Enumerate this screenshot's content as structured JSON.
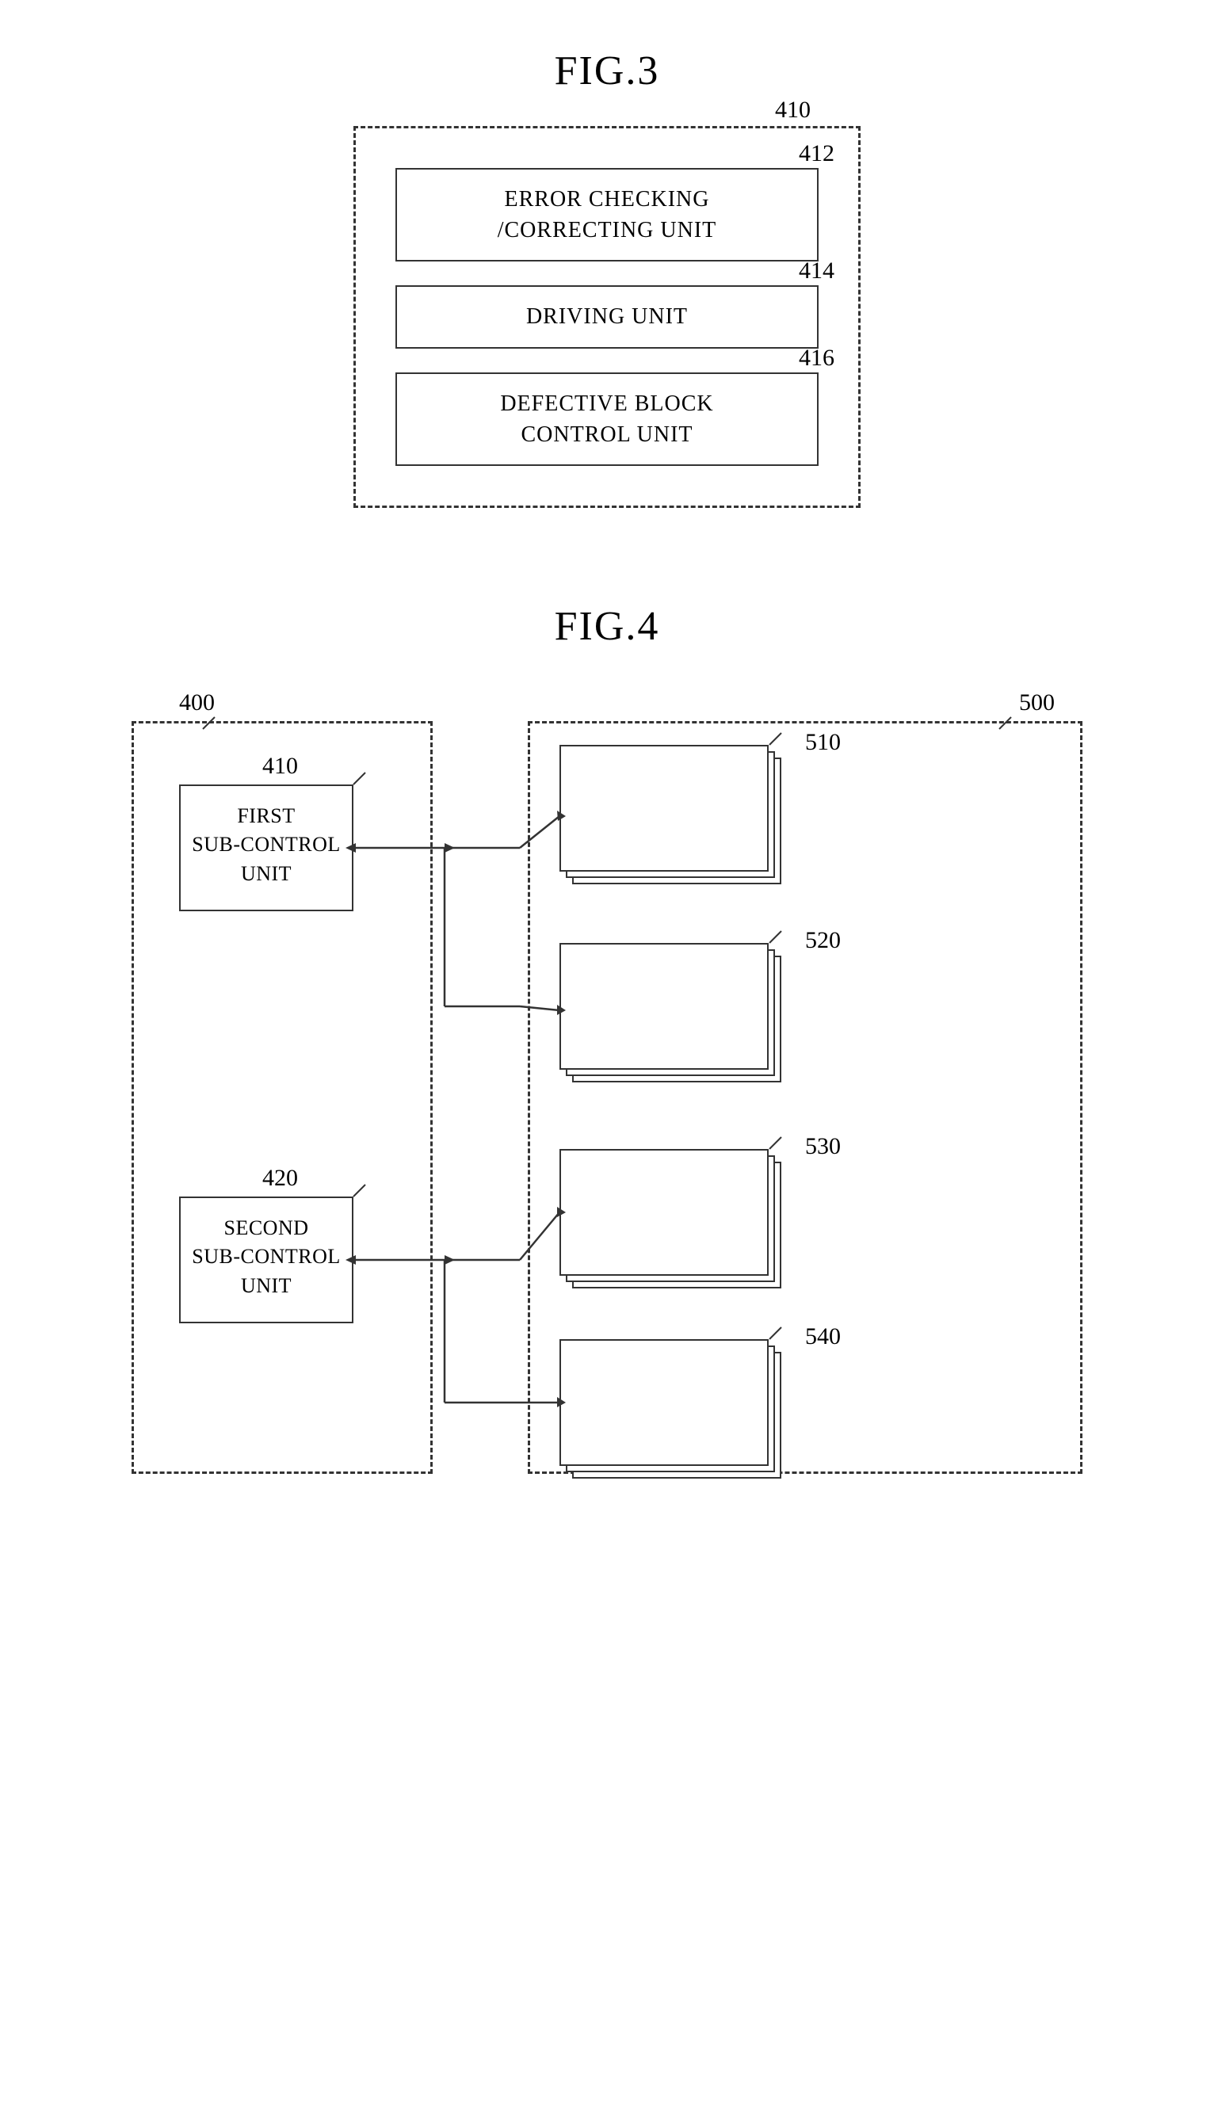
{
  "fig3": {
    "title": "FIG.3",
    "outer_ref": "410",
    "units": [
      {
        "ref": "412",
        "lines": [
          "ERROR CHECKING",
          "/CORRECTING UNIT"
        ]
      },
      {
        "ref": "414",
        "lines": [
          "DRIVING UNIT"
        ]
      },
      {
        "ref": "416",
        "lines": [
          "DEFECTIVE BLOCK",
          "CONTROL UNIT"
        ]
      }
    ]
  },
  "fig4": {
    "title": "FIG.4",
    "refs": {
      "r400": "400",
      "r500": "500",
      "r410": "410",
      "r420": "420",
      "r510": "510",
      "r520": "520",
      "r530": "530",
      "r540": "540"
    },
    "left_units": [
      {
        "id": "410",
        "lines": [
          "FIRST",
          "SUB-CONTROL",
          "UNIT"
        ]
      },
      {
        "id": "420",
        "lines": [
          "SECOND",
          "SUB-CONTROL",
          "UNIT"
        ]
      }
    ]
  }
}
